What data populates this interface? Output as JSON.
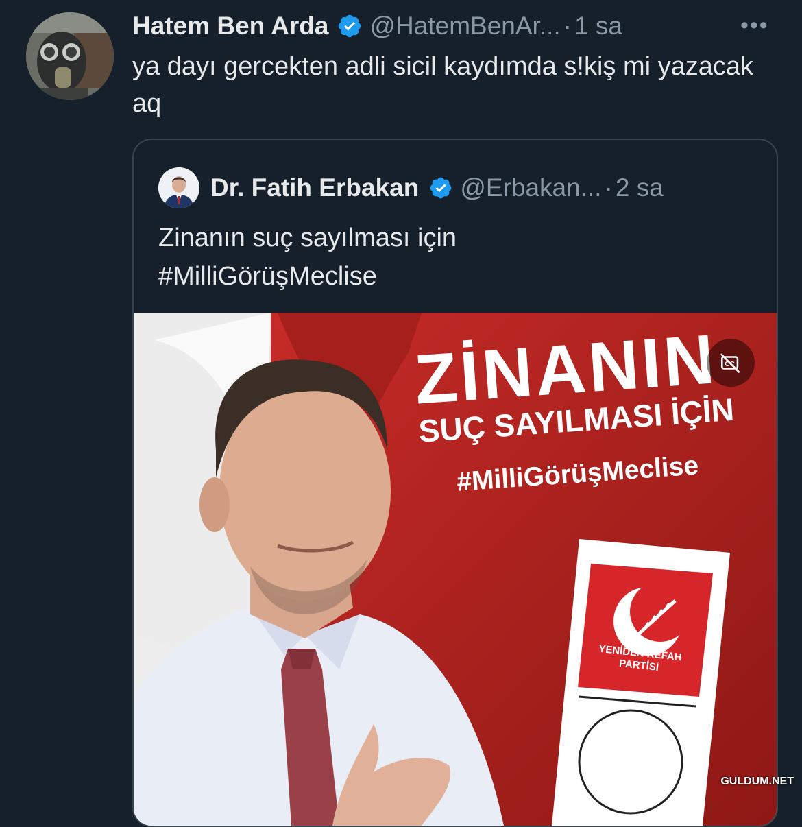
{
  "tweet": {
    "author_name": "Hatem Ben Arda",
    "handle": "@HatemBenAr...",
    "separator": "·",
    "time": "1 sa",
    "more_icon": "more-icon",
    "more_glyph": "•••",
    "text": "ya dayı gercekten adli sicil kaydımda s!kiş mi yazacak aq",
    "verified_icon": "verified-badge-icon"
  },
  "quoted": {
    "author_name": "Dr. Fatih Erbakan",
    "handle": "@Erbakan...",
    "separator": "·",
    "time": "2 sa",
    "text_line1": "Zinanın suç sayılması için",
    "text_line2": "#MilliGörüşMeclise",
    "media": {
      "headline": "ZİNANIN",
      "subline": "SUÇ SAYILMASI İÇİN",
      "hashtag": "#MilliGörüşMeclise",
      "party_line1": "YENİDEN REFAH",
      "party_line2": "PARTİSİ",
      "cc_icon": "closed-captions-off-icon"
    }
  },
  "watermark": "GULDUM.NET",
  "colors": {
    "background": "#15202b",
    "text": "#e7e9ea",
    "muted": "#8b98a5",
    "verified": "#1d9bf0",
    "border": "#38444d",
    "poster_red": "#b5231f"
  }
}
